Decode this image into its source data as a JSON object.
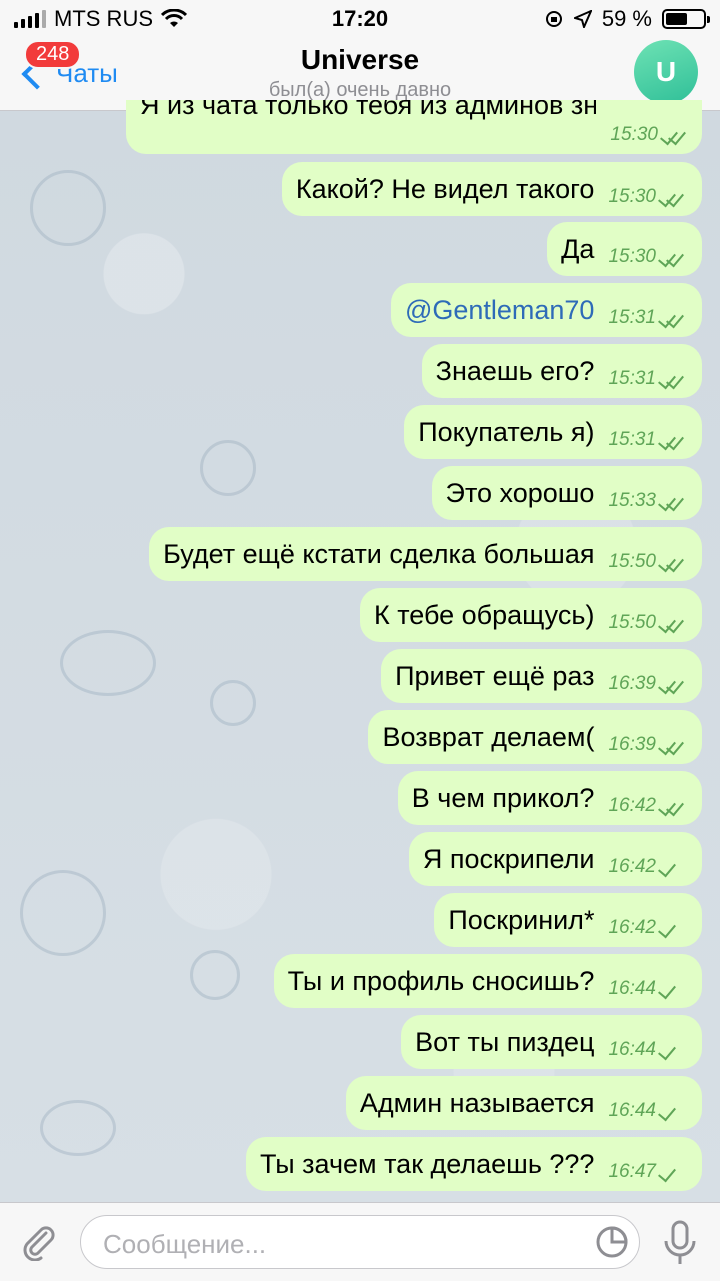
{
  "status_bar": {
    "carrier": "MTS RUS",
    "time": "17:20",
    "battery_percent": "59 %",
    "battery_level": 0.59
  },
  "header": {
    "back_label": "Чаты",
    "unread_badge": "248",
    "title": "Universe",
    "subtitle": "был(а) очень давно",
    "avatar_letter": "U",
    "avatar_color": "#43d1a6"
  },
  "messages": [
    {
      "text": "Я из чата только тебя из админов знаю",
      "time": "15:30",
      "read": true
    },
    {
      "text": "Какой? Не видел такого",
      "time": "15:30",
      "read": true
    },
    {
      "text": "Да",
      "time": "15:30",
      "read": true
    },
    {
      "text": "@Gentleman70",
      "time": "15:31",
      "read": true,
      "link": true
    },
    {
      "text": "Знаешь его?",
      "time": "15:31",
      "read": true
    },
    {
      "text": "Покупатель я)",
      "time": "15:31",
      "read": true
    },
    {
      "text": "Это хорошо",
      "time": "15:33",
      "read": true
    },
    {
      "text": "Будет ещё кстати сделка большая",
      "time": "15:50",
      "read": true
    },
    {
      "text": "К тебе обращусь)",
      "time": "15:50",
      "read": true
    },
    {
      "text": "Привет ещё раз",
      "time": "16:39",
      "read": true
    },
    {
      "text": "Возврат делаем(",
      "time": "16:39",
      "read": true
    },
    {
      "text": "В чем прикол?",
      "time": "16:42",
      "read": true
    },
    {
      "text": "Я поскрипели",
      "time": "16:42",
      "read": false
    },
    {
      "text": "Поскринил*",
      "time": "16:42",
      "read": false
    },
    {
      "text": "Ты и профиль сносишь?",
      "time": "16:44",
      "read": false
    },
    {
      "text": "Вот ты пиздец",
      "time": "16:44",
      "read": false
    },
    {
      "text": "Админ называется",
      "time": "16:44",
      "read": false
    },
    {
      "text": "Ты зачем так делаешь ???",
      "time": "16:47",
      "read": false
    }
  ],
  "composer": {
    "placeholder": "Сообщение..."
  },
  "colors": {
    "bubble": "#e1fec6",
    "accent": "#1f8bf2",
    "time_green": "#5fa557",
    "badge_red": "#f23b3b"
  }
}
